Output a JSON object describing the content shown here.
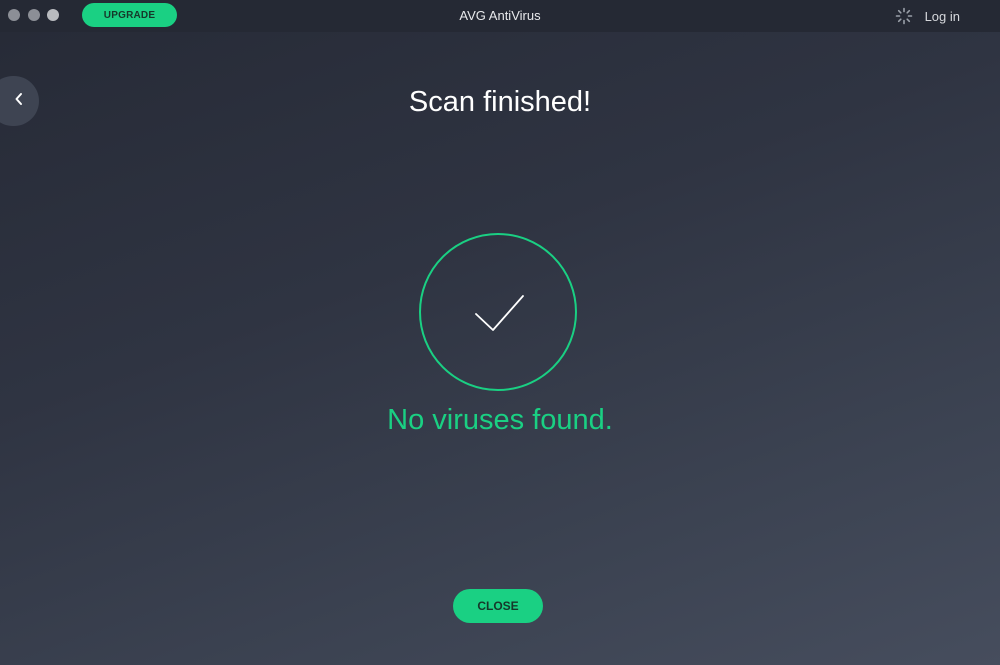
{
  "window": {
    "title": "AVG AntiVirus"
  },
  "toolbar": {
    "upgrade_label": "UPGRADE",
    "login_label": "Log in",
    "login_icon": "spinner-icon"
  },
  "navigation": {
    "back_icon": "chevron-left-icon"
  },
  "main": {
    "title": "Scan finished!",
    "status_icon": "checkmark-icon",
    "result": "No viruses found.",
    "close_label": "CLOSE"
  },
  "colors": {
    "accent": "#1ad083",
    "background": "#2f3442",
    "titlebar": "#252934"
  }
}
